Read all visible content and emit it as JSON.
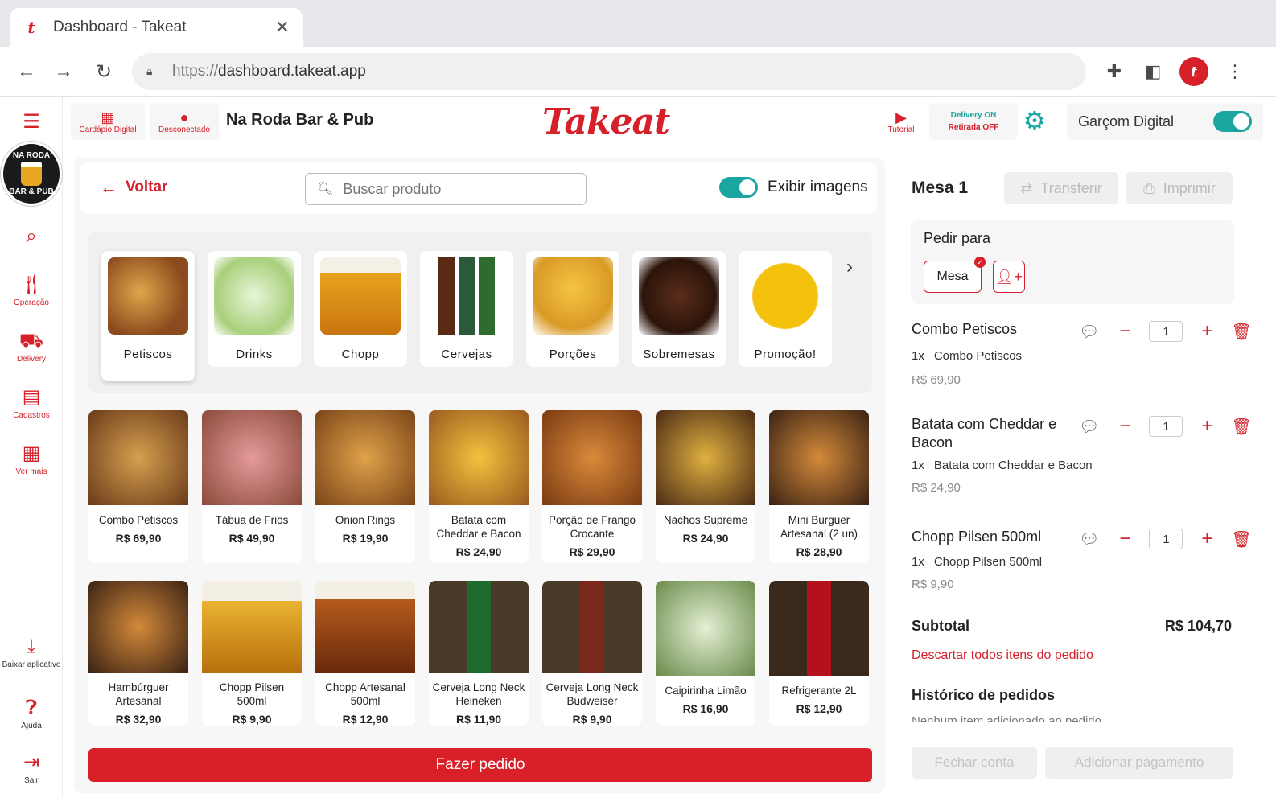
{
  "browser": {
    "tab_title": "Dashboard - Takeat",
    "url_prefix": "https://",
    "url_rest": "dashboard.takeat.app"
  },
  "sidebar": {
    "logo_text_top": "NA RODA",
    "logo_text_bottom": "BAR & PUB",
    "items": [
      {
        "label": "Operação"
      },
      {
        "label": "Delivery"
      },
      {
        "label": "Cadastros"
      },
      {
        "label": "Ver mais"
      },
      {
        "label": "Baixar aplicativo"
      },
      {
        "label": "Ajuda"
      },
      {
        "label": "Sair"
      }
    ]
  },
  "topbar": {
    "cardapio": "Cardápio Digital",
    "desconectado": "Desconectado",
    "store_name": "Na Roda Bar & Pub",
    "brand": "Takeat",
    "tutorial": "Tutorial",
    "delivery_on": "Delivery ON",
    "retirada_off": "Retirada OFF",
    "garcom": "Garçom Digital"
  },
  "search": {
    "voltar": "Voltar",
    "placeholder": "Buscar produto",
    "exibir": "Exibir imagens"
  },
  "categories": [
    {
      "label": "Petiscos",
      "active": true
    },
    {
      "label": "Drinks"
    },
    {
      "label": "Chopp"
    },
    {
      "label": "Cervejas"
    },
    {
      "label": "Porções"
    },
    {
      "label": "Sobremesas"
    },
    {
      "label": "Promoção!"
    }
  ],
  "products": [
    {
      "name": "Combo Petiscos",
      "price": "R$ 69,90"
    },
    {
      "name": "Tábua de Frios",
      "price": "R$ 49,90"
    },
    {
      "name": "Onion Rings",
      "price": "R$ 19,90"
    },
    {
      "name": "Batata com Cheddar e Bacon",
      "price": "R$ 24,90"
    },
    {
      "name": "Porção de Frango Crocante",
      "price": "R$ 29,90"
    },
    {
      "name": "Nachos Supreme",
      "price": "R$ 24,90"
    },
    {
      "name": "Mini Burguer Artesanal (2 un)",
      "price": "R$ 28,90"
    },
    {
      "name": "Hambúrguer Artesanal",
      "price": "R$ 32,90"
    },
    {
      "name": "Chopp Pilsen 500ml",
      "price": "R$ 9,90"
    },
    {
      "name": "Chopp Artesanal 500ml",
      "price": "R$ 12,90"
    },
    {
      "name": "Cerveja Long Neck Heineken",
      "price": "R$ 11,90"
    },
    {
      "name": "Cerveja Long Neck Budweiser",
      "price": "R$ 9,90"
    },
    {
      "name": "Caipirinha Limão",
      "price": "R$ 16,90"
    },
    {
      "name": "Refrigerante 2L",
      "price": "R$ 12,90"
    }
  ],
  "fazer_pedido": "Fazer pedido",
  "order": {
    "title": "Mesa 1",
    "transferir": "Transferir",
    "imprimir": "Imprimir",
    "pedir_para": "Pedir para",
    "mesa_btn": "Mesa",
    "items": [
      {
        "name": "Combo Petiscos",
        "qty_prefix": "1x",
        "detail": "Combo Petiscos",
        "price": "R$ 69,90",
        "qty": "1"
      },
      {
        "name": "Batata com Cheddar e Bacon",
        "qty_prefix": "1x",
        "detail": "Batata com Cheddar e Bacon",
        "price": "R$ 24,90",
        "qty": "1"
      },
      {
        "name": "Chopp Pilsen 500ml",
        "qty_prefix": "1x",
        "detail": "Chopp Pilsen 500ml",
        "price": "R$ 9,90",
        "qty": "1"
      }
    ],
    "subtotal_label": "Subtotal",
    "subtotal_value": "R$ 104,70",
    "descartar": "Descartar todos itens do pedido",
    "historico": "Histórico de pedidos",
    "historico_empty": "Nenhum item adicionado ao pedido",
    "fechar": "Fechar conta",
    "adicionar": "Adicionar pagamento"
  },
  "colors": {
    "brand_red": "#d6202a",
    "teal": "#1aa6a0"
  }
}
